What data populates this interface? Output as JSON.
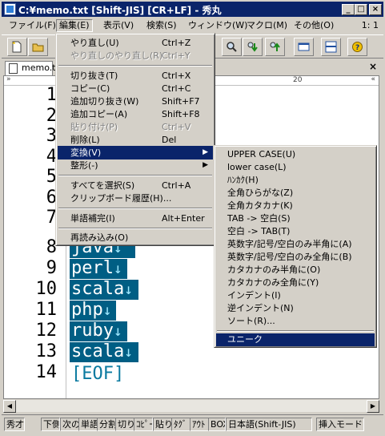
{
  "window": {
    "title": "C:¥memo.txt  [Shift-JIS] [CR+LF] - 秀丸",
    "min_label": "_",
    "max_label": "□",
    "close_label": "×"
  },
  "menubar": {
    "items": [
      {
        "label": "ファイル(F)"
      },
      {
        "label": "編集(E)"
      },
      {
        "label": "表示(V)"
      },
      {
        "label": "検索(S)"
      },
      {
        "label": "ウィンドウ(W)"
      },
      {
        "label": "マクロ(M)"
      },
      {
        "label": "その他(O)"
      }
    ],
    "cursor_pos": "1: 1"
  },
  "tab": {
    "label": "memo.t",
    "close_label": "×"
  },
  "ruler": {
    "mark": "20",
    "left_glyph": "»",
    "right_glyph": "«"
  },
  "editor": {
    "line_numbers": [
      "1",
      "2",
      "3",
      "4",
      "5",
      "6",
      "7",
      "8",
      "9",
      "10",
      "11",
      "12",
      "13",
      "14"
    ],
    "visible_code": [
      {
        "line": 8,
        "text": "java"
      },
      {
        "line": 9,
        "text": "perl"
      },
      {
        "line": 10,
        "text": "scala"
      },
      {
        "line": 11,
        "text": "php"
      },
      {
        "line": 12,
        "text": "ruby"
      },
      {
        "line": 13,
        "text": "scala"
      }
    ],
    "return_glyph": "↓",
    "eof": "[EOF]"
  },
  "edit_menu": {
    "items": [
      {
        "label": "やり直し(U)",
        "accel": "Ctrl+Z",
        "disabled": false
      },
      {
        "label": "やり直しのやり直し(R)",
        "accel": "Ctrl+Y",
        "disabled": true
      },
      {
        "label": "切り抜き(T)",
        "accel": "Ctrl+X",
        "disabled": false
      },
      {
        "label": "コピー(C)",
        "accel": "Ctrl+C",
        "disabled": false
      },
      {
        "label": "追加切り抜き(W)",
        "accel": "Shift+F7",
        "disabled": false
      },
      {
        "label": "追加コピー(A)",
        "accel": "Shift+F8",
        "disabled": false
      },
      {
        "label": "貼り付け(P)",
        "accel": "Ctrl+V",
        "disabled": true
      },
      {
        "label": "削除(L)",
        "accel": "Del",
        "disabled": false
      },
      {
        "label": "変換(V)",
        "accel": "",
        "disabled": false,
        "highlighted": true,
        "submenu": true
      },
      {
        "label": "整形(-)",
        "accel": "",
        "disabled": false,
        "submenu": true
      },
      {
        "label": "すべてを選択(S)",
        "accel": "Ctrl+A",
        "disabled": false
      },
      {
        "label": "クリップボード履歴(H)...",
        "accel": "",
        "disabled": false
      },
      {
        "label": "単語補完(I)",
        "accel": "Alt+Enter",
        "disabled": false
      },
      {
        "label": "再読み込み(O)",
        "accel": "",
        "disabled": false
      }
    ],
    "submenu_arrow": "▶"
  },
  "convert_submenu": {
    "items": [
      {
        "label": "UPPER CASE(U)"
      },
      {
        "label": "lower case(L)"
      },
      {
        "label": "ﾊﾝｶｸ(H)"
      },
      {
        "label": "全角ひらがな(Z)"
      },
      {
        "label": "全角カタカナ(K)"
      },
      {
        "label": "TAB -> 空白(S)"
      },
      {
        "label": "空白 -> TAB(T)"
      },
      {
        "label": "英数字/記号/空白のみ半角に(A)"
      },
      {
        "label": "英数字/記号/空白のみ全角に(B)"
      },
      {
        "label": "カタカナのみ半角に(O)"
      },
      {
        "label": "カタカナのみ全角に(Y)"
      },
      {
        "label": "インデント(I)"
      },
      {
        "label": "逆インデント(N)"
      },
      {
        "label": "ソート(R)..."
      },
      {
        "label": "ユニーク",
        "highlighted": true
      }
    ]
  },
  "scrollbar": {
    "left_arrow": "◀",
    "right_arrow": "▶"
  },
  "statusbar": {
    "items": [
      {
        "label": "秀才"
      },
      {
        "label": "下側"
      },
      {
        "label": "次の"
      },
      {
        "label": "単語"
      },
      {
        "label": "分割"
      },
      {
        "label": "切り"
      },
      {
        "label": "ｺﾋﾟｰ"
      },
      {
        "label": "貼り"
      },
      {
        "label": "ﾀｸﾞ"
      },
      {
        "label": "ｱｳﾄ"
      },
      {
        "label": "BOX"
      },
      {
        "label": "日本語(Shift-JIS)"
      },
      {
        "label": "挿入モード"
      }
    ]
  },
  "colors": {
    "titlebar": "#0a246a",
    "selection": "#005e84",
    "menu_highlight": "#0a246a",
    "eof": "#0a7aa0"
  }
}
